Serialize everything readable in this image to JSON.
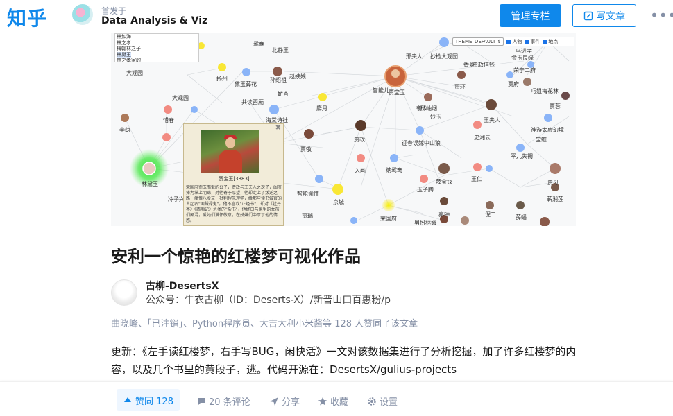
{
  "header": {
    "logo": "知乎",
    "published_in_label": "首发于",
    "column_name": "Data Analysis & Viz",
    "manage_button": "管理专栏",
    "write_button": "写文章",
    "more": "•••"
  },
  "visualization": {
    "list_items": [
      "林如海",
      "林之孝",
      "梅翰林之子",
      "林黛玉",
      "林之孝家的"
    ],
    "selected_item": "林黛玉",
    "theme_select": "THEME_DEFAULT ⇕",
    "checkboxes": [
      "人物",
      "事件",
      "地点"
    ],
    "popup": {
      "close": "✖",
      "caption": "贾宝玉[3883]",
      "description": "荣国府衔玉而诞的公子，贾政与王夫人之次子，阖府捧为掌上明珠，对他寄予厚望，他却走上了叛逆之路，痛恨八股文，批判程朱理学，给那些读书做官的人起名\"国贼禄鬼\"。他不喜欢\"正经书\"，却对《牡丹亭》《西厢记》之类的\"杂书\"，他终日与家里的女孩们厮混，爱她们满怀敬意，在姊妹们中厚了他的情感。"
    },
    "labels": [
      "鸳鸯",
      "北静王",
      "邢夫人",
      "抄检大观园",
      "贾府",
      "金玉良缘",
      "大观园",
      "扬州",
      "黛玉葬花",
      "赵姨娘",
      "孙绍祖",
      "袭人",
      "智能儿",
      "贾宝玉",
      "贾环",
      "鸳鸯",
      "贾政借钱",
      "荣宁二府",
      "贾琏",
      "共读西厢",
      "娇杏",
      "麝月",
      "邢岫烟",
      "巧姐梅花林",
      "薛宝钗",
      "海棠诗社",
      "李纨",
      "惜春",
      "贾政",
      "迎春误嫁中山狼",
      "王夫人",
      "袭人",
      "神游太虚幻境",
      "晴雯",
      "林黛玉",
      "冷子兴",
      "贾敬",
      "平儿失镯",
      "史湘云",
      "入画",
      "纳鸳鸯",
      "薛宝钗",
      "贾母",
      "王仁",
      "玉子腾",
      "凤姐",
      "京城",
      "荣国府",
      "智能偷情",
      "秦钟",
      "男扮林姆",
      "倪二",
      "薛蟠",
      "蕲湘莲",
      "香菱",
      "贾蓉",
      "大观园",
      "妙玉",
      "贾瑞",
      "宝蟾",
      "乌进孝"
    ]
  },
  "article": {
    "title": "安利一个惊艳的红楼梦可视化作品",
    "author_name": "古柳-DesertsX",
    "author_bio": "公众号：牛衣古柳（ID：Deserts-X）/新晋山口百惠粉/p",
    "likers": "曲晓峰、「已注销」、Python程序员、大吉大利小米酱等 128 人赞同了该文章",
    "body_prefix": "更新：",
    "body_link1": "《左手读红楼梦，右手写BUG，闲快活》",
    "body_middle": "一文对该数据集进行了分析挖掘，加了许多红楼梦的内容，以及几个书里的黄段子，逃。代码开源在：",
    "body_link2": "DesertsX/gulius-projects"
  },
  "actions": {
    "vote": "赞同 128",
    "comments": "20 条评论",
    "share": "分享",
    "favorite": "收藏",
    "settings": "设置"
  },
  "colors": {
    "brand": "#0f88eb",
    "node_blue": "#8ab4f8",
    "node_red": "#f28b82",
    "node_yellow": "#f9e735",
    "node_highlight": "#34e034"
  }
}
